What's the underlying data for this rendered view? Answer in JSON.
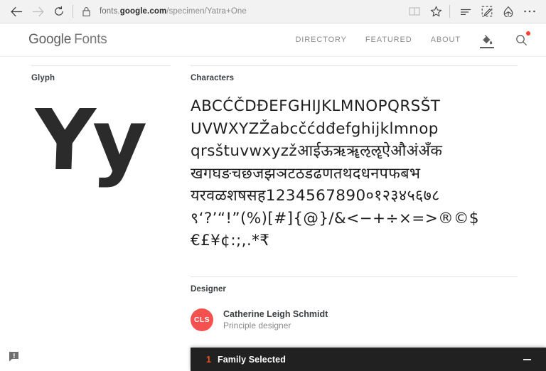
{
  "browser": {
    "back_icon": "back-arrow-icon",
    "forward_icon": "forward-arrow-icon",
    "refresh_icon": "refresh-icon",
    "lock_icon": "lock-icon",
    "url_prefix": "fonts.",
    "url_domain": "google.com",
    "url_path": "/specimen/Yatra+One",
    "url_full": "fonts.google.com/specimen/Yatra+One",
    "actions": [
      {
        "name": "reading-view-icon",
        "title": "Reading view"
      },
      {
        "name": "favorites-star-icon",
        "title": "Add to favorites"
      },
      {
        "name": "hub-icon",
        "title": "Hub"
      },
      {
        "name": "web-note-icon",
        "title": "Make a Web Note"
      },
      {
        "name": "share-icon",
        "title": "Share"
      },
      {
        "name": "more-icon",
        "title": "More"
      }
    ]
  },
  "site_header": {
    "logo_google": "Google",
    "logo_fonts": "Fonts",
    "nav": [
      {
        "label": "DIRECTORY"
      },
      {
        "label": "FEATURED"
      },
      {
        "label": "ABOUT"
      }
    ],
    "paint_icon": "paint-bucket-icon",
    "search_icon": "search-icon",
    "search_badge": true
  },
  "glyph_panel": {
    "label": "Glyph",
    "sample": "Yy"
  },
  "characters_panel": {
    "label": "Characters",
    "rows": [
      "ABCĆČDĐEFGHIJKLMNOPQRSŠT",
      "UVWXYZŽabcčćdđefghijklmnop",
      "qrsštuvwxyzžआईऊऋॠऌॡऐऔअंअँक",
      "खगघङचछजझञटठडढणतथदधनपफबभ",
      "यरवळशषसह1234567890०१२३४५६७८",
      "९‘?’“!”(%)[#]{@}/&<−+÷×=>®©$",
      "€£¥¢:;,.*₹"
    ]
  },
  "designer_panel": {
    "label": "Designer",
    "avatar_initials": "CLS",
    "name": "Catherine Leigh Schmidt",
    "role": "Principle designer"
  },
  "feedback": {
    "icon": "feedback-icon"
  },
  "selection_drawer": {
    "count": "1",
    "label": "Family Selected",
    "minimize_icon": "minimize-icon"
  },
  "colors": {
    "accent_orange": "#f4511e",
    "avatar_red": "#f4514f",
    "badge_red": "#ff3d2e",
    "drawer_bg": "#212121",
    "text_primary": "#1f1f1f",
    "text_muted": "#8a8a8a"
  }
}
